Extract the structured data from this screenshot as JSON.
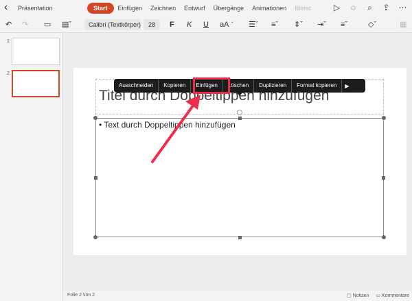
{
  "header": {
    "back_icon": "chevron-left-icon",
    "doc_title": "Präsentation",
    "tabs": [
      {
        "label": "Start",
        "active": true
      },
      {
        "label": "Einfügen"
      },
      {
        "label": "Zeichnen"
      },
      {
        "label": "Entwurf"
      },
      {
        "label": "Übergänge"
      },
      {
        "label": "Animationen"
      },
      {
        "label": "Bildsc"
      }
    ],
    "icons": [
      "play-icon",
      "lightbulb-icon",
      "search-icon",
      "share-icon",
      "more-icon"
    ]
  },
  "ribbon": {
    "font_name": "Calibri (Textkörper)",
    "font_size": "28",
    "bold": "F",
    "italic": "K",
    "underline": "U",
    "text_case": "aA"
  },
  "thumbnails": [
    {
      "number": "1",
      "selected": false
    },
    {
      "number": "2",
      "selected": true
    }
  ],
  "slide": {
    "title_placeholder": "Titel durch Doppeltippen hinzufügen",
    "body_placeholder": "• Text durch Doppeltippen hinzufügen"
  },
  "context_menu": {
    "items": [
      "Ausschneiden",
      "Kopieren",
      "Einfügen",
      "Löschen",
      "Duplizieren",
      "Format kopieren"
    ],
    "highlighted": "Einfügen"
  },
  "status": {
    "slide_count": "Folie 2 von 2",
    "notes": "Notizen",
    "comments": "Kommentare"
  },
  "colors": {
    "accent": "#d24726",
    "highlight": "#ee2d4a"
  }
}
